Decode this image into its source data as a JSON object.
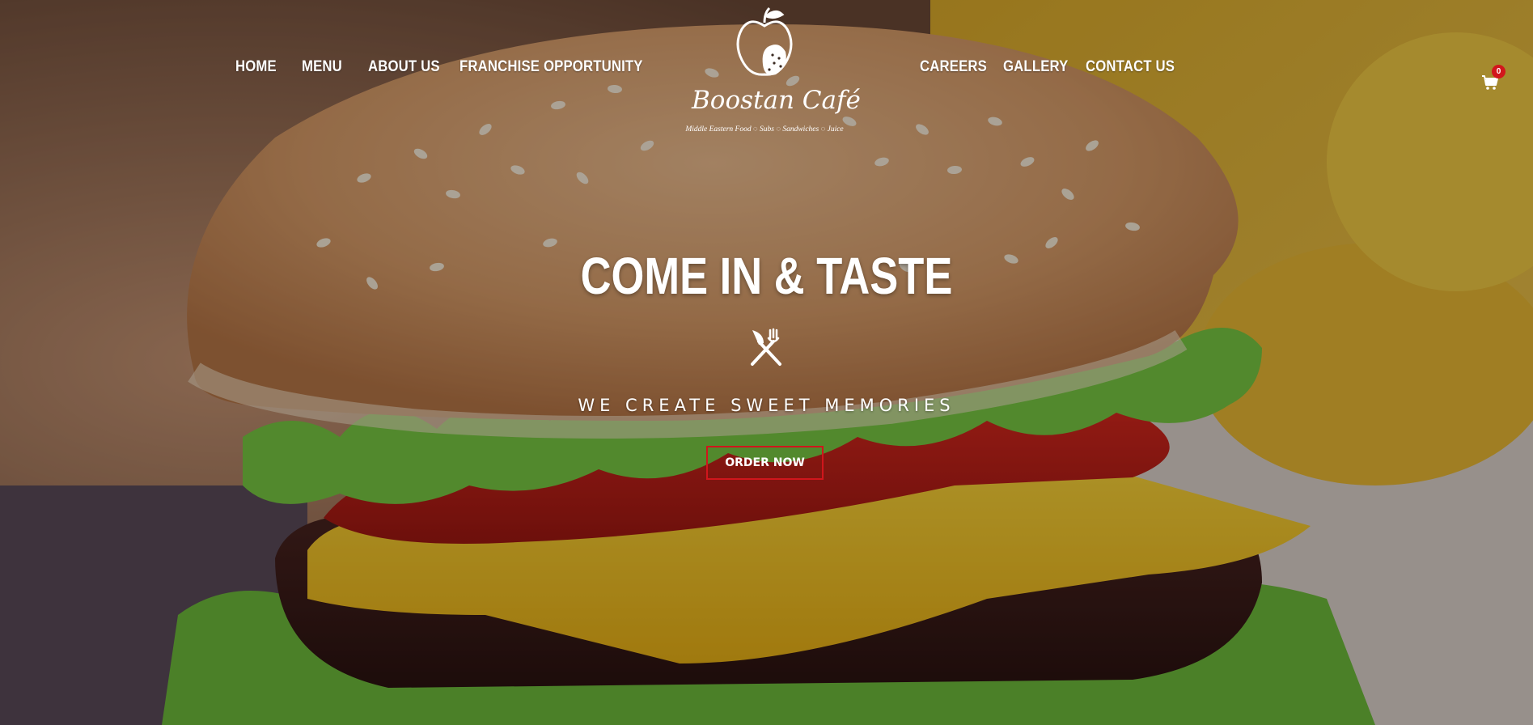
{
  "nav": {
    "left": [
      {
        "label": "HOME"
      },
      {
        "label": "MENU"
      },
      {
        "label": "ABOUT US"
      },
      {
        "label": "FRANCHISE OPPORTUNITY"
      }
    ],
    "right": [
      {
        "label": "CAREERS"
      },
      {
        "label": "GALLERY"
      },
      {
        "label": "CONTACT US"
      }
    ]
  },
  "logo": {
    "name": "Boostan Café",
    "tagline": "Middle Eastern Food ◌ Subs ◌ Sandwiches ◌ Juice",
    "icon": "apple-logo-icon"
  },
  "cart": {
    "icon": "shopping-cart-icon",
    "count": "0",
    "badge_color": "#d2161c"
  },
  "hero": {
    "headline": "COME IN & TASTE",
    "divider_icon": "fork-knife-crossed-icon",
    "tagline": "WE CREATE SWEET MEMORIES",
    "cta_label": "ORDER NOW",
    "cta_border_color": "#d0161c",
    "background_image": "burger-photo"
  }
}
